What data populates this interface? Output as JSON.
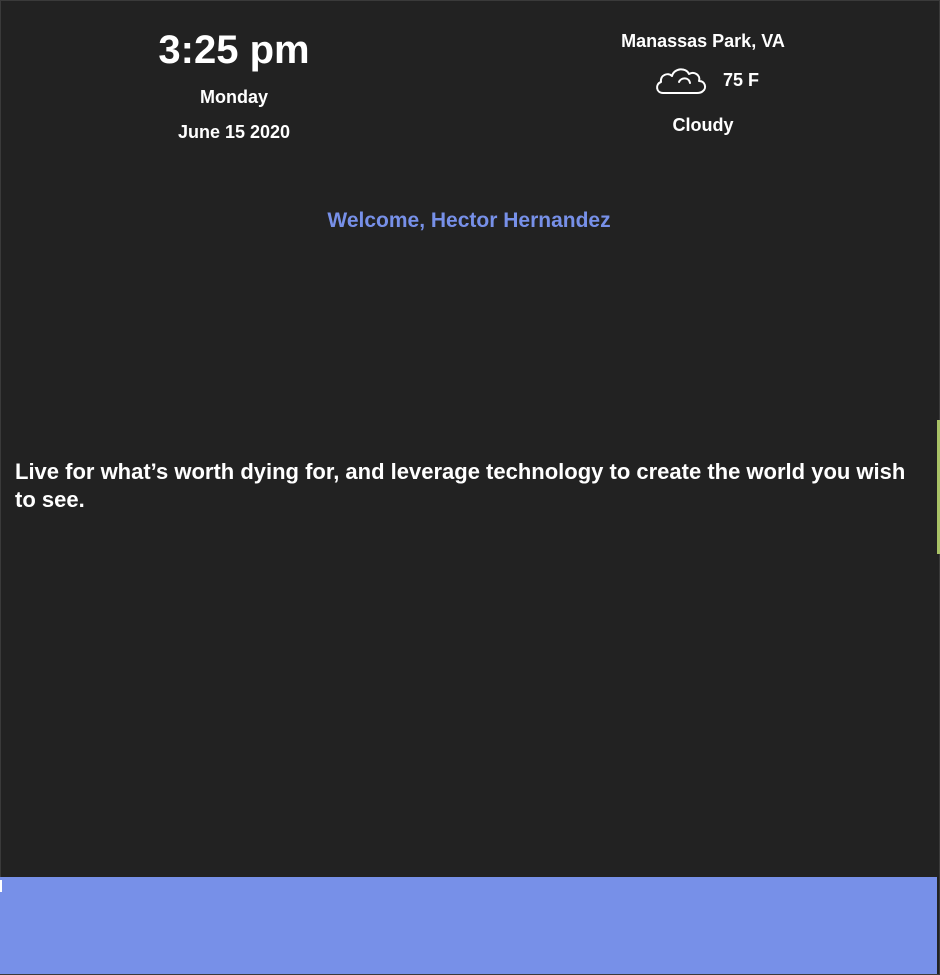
{
  "clock": {
    "time": "3:25 pm",
    "day": "Monday",
    "date": "June 15 2020"
  },
  "weather": {
    "location": "Manassas Park, VA",
    "icon": "cloudy-icon",
    "temperature": "75 F",
    "condition": "Cloudy"
  },
  "welcome": {
    "text": "Welcome, Hector Hernandez"
  },
  "quote": {
    "text": "Live for what’s worth dying for, and leverage technology to create the world you wish to see."
  },
  "colors": {
    "background": "#222222",
    "accent": "#7790e8",
    "text": "#ffffff",
    "side_accent": "#a9c267"
  }
}
